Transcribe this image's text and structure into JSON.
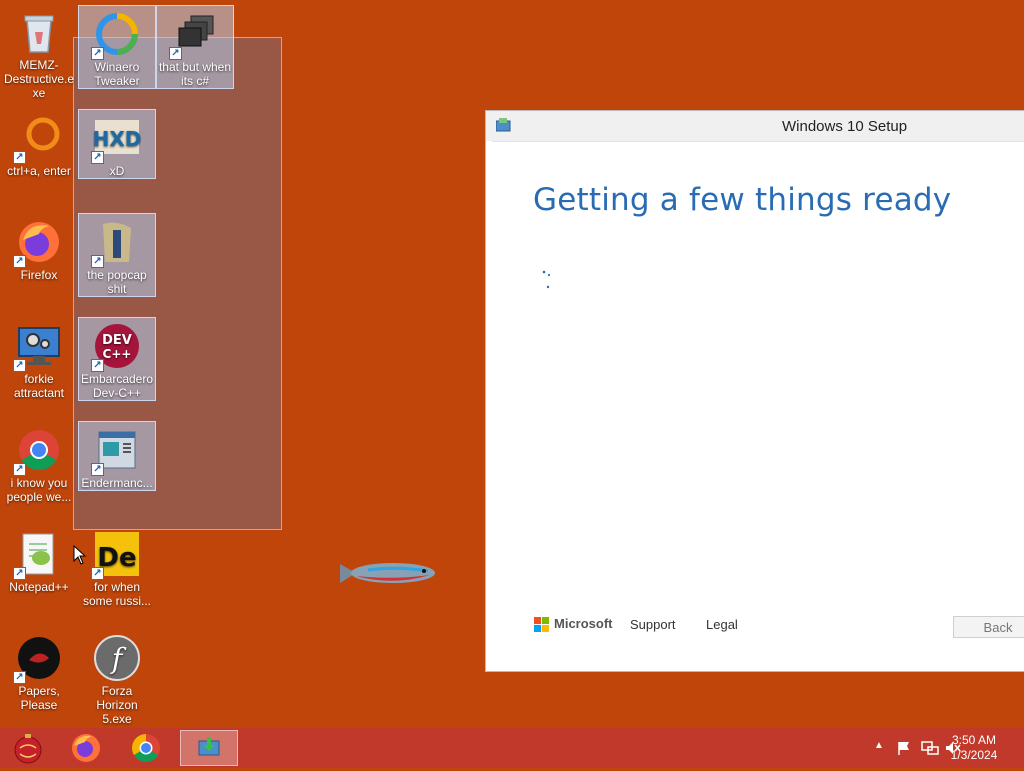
{
  "desktop": {
    "icons": [
      {
        "label": "MEMZ-Destructive.exe"
      },
      {
        "label": "Winaero Tweaker"
      },
      {
        "label": "that but when its c#"
      },
      {
        "label": "ctrl+a, enter"
      },
      {
        "label": "xD"
      },
      {
        "label": "Firefox"
      },
      {
        "label": "the popcap shit"
      },
      {
        "label": "forkie attractant"
      },
      {
        "label": "Embarcadero Dev-C++"
      },
      {
        "label": "i know you people we..."
      },
      {
        "label": "Endermanc..."
      },
      {
        "label": "Notepad++"
      },
      {
        "label": "for when some russi..."
      },
      {
        "label": "Papers, Please"
      },
      {
        "label": "Forza Horizon 5.exe"
      }
    ],
    "icon_glyphs": {
      "hxd": "HXD",
      "devcpp": "DEV C++",
      "dx": "De"
    }
  },
  "setup_window": {
    "title": "Windows 10 Setup",
    "heading": "Getting a few things ready",
    "footer": {
      "brand": "Microsoft",
      "support": "Support",
      "legal": "Legal"
    },
    "back_label": "Back"
  },
  "taskbar": {
    "time": "3:50 AM",
    "date": "1/3/2024"
  },
  "colors": {
    "desktop_bg": "#c0450a",
    "taskbar_bg": "#c0392b",
    "heading_blue": "#2a6cb4"
  }
}
